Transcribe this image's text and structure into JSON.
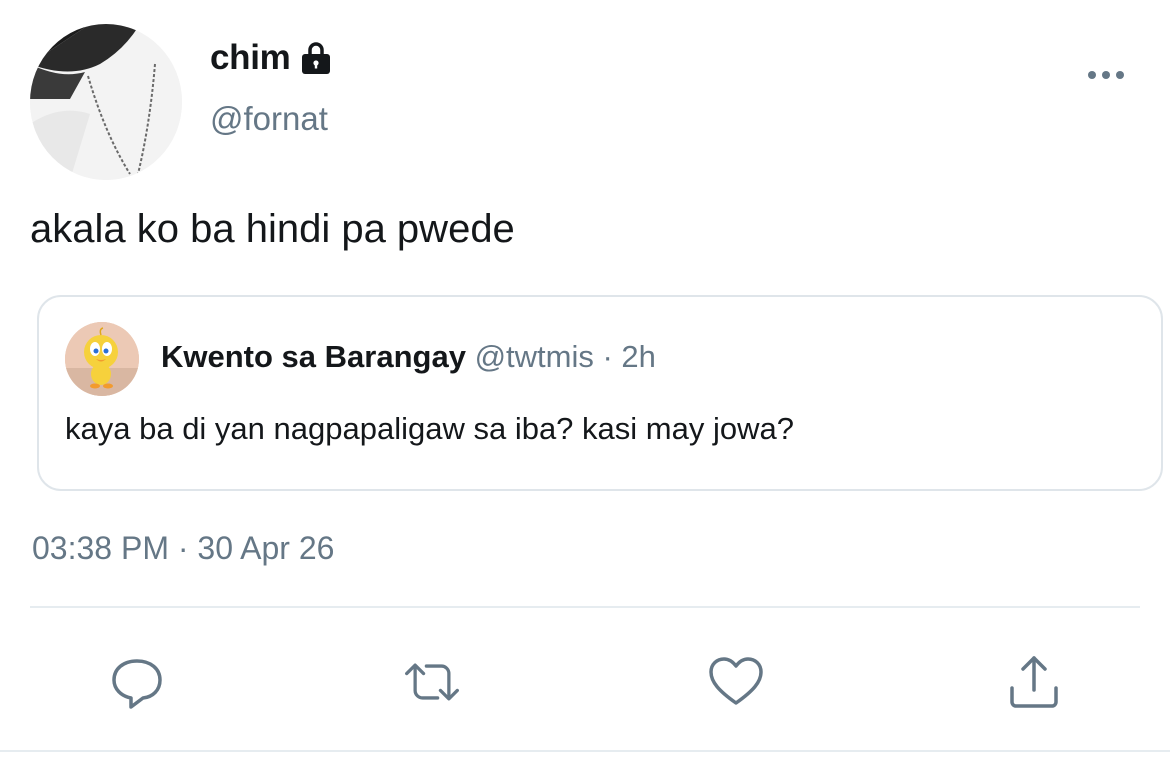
{
  "tweet": {
    "author": {
      "display_name": "chim",
      "handle": "@fornat",
      "locked": true
    },
    "text": "akala ko ba hindi pa pwede",
    "quoted": {
      "display_name": "Kwento sa Barangay",
      "handle": "@twtmis",
      "separator": " · ",
      "age": "2h",
      "text": "kaya ba di yan nagpapaligaw sa iba? kasi may jowa?"
    },
    "timestamp": "03:38 PM · 30 Apr 26"
  },
  "actions": [
    {
      "icon": "reply-icon"
    },
    {
      "icon": "retweet-icon"
    },
    {
      "icon": "like-icon"
    },
    {
      "icon": "share-icon"
    }
  ],
  "colors": {
    "text_primary": "#14171a",
    "text_secondary": "#657786",
    "border": "#dfe5ea"
  }
}
